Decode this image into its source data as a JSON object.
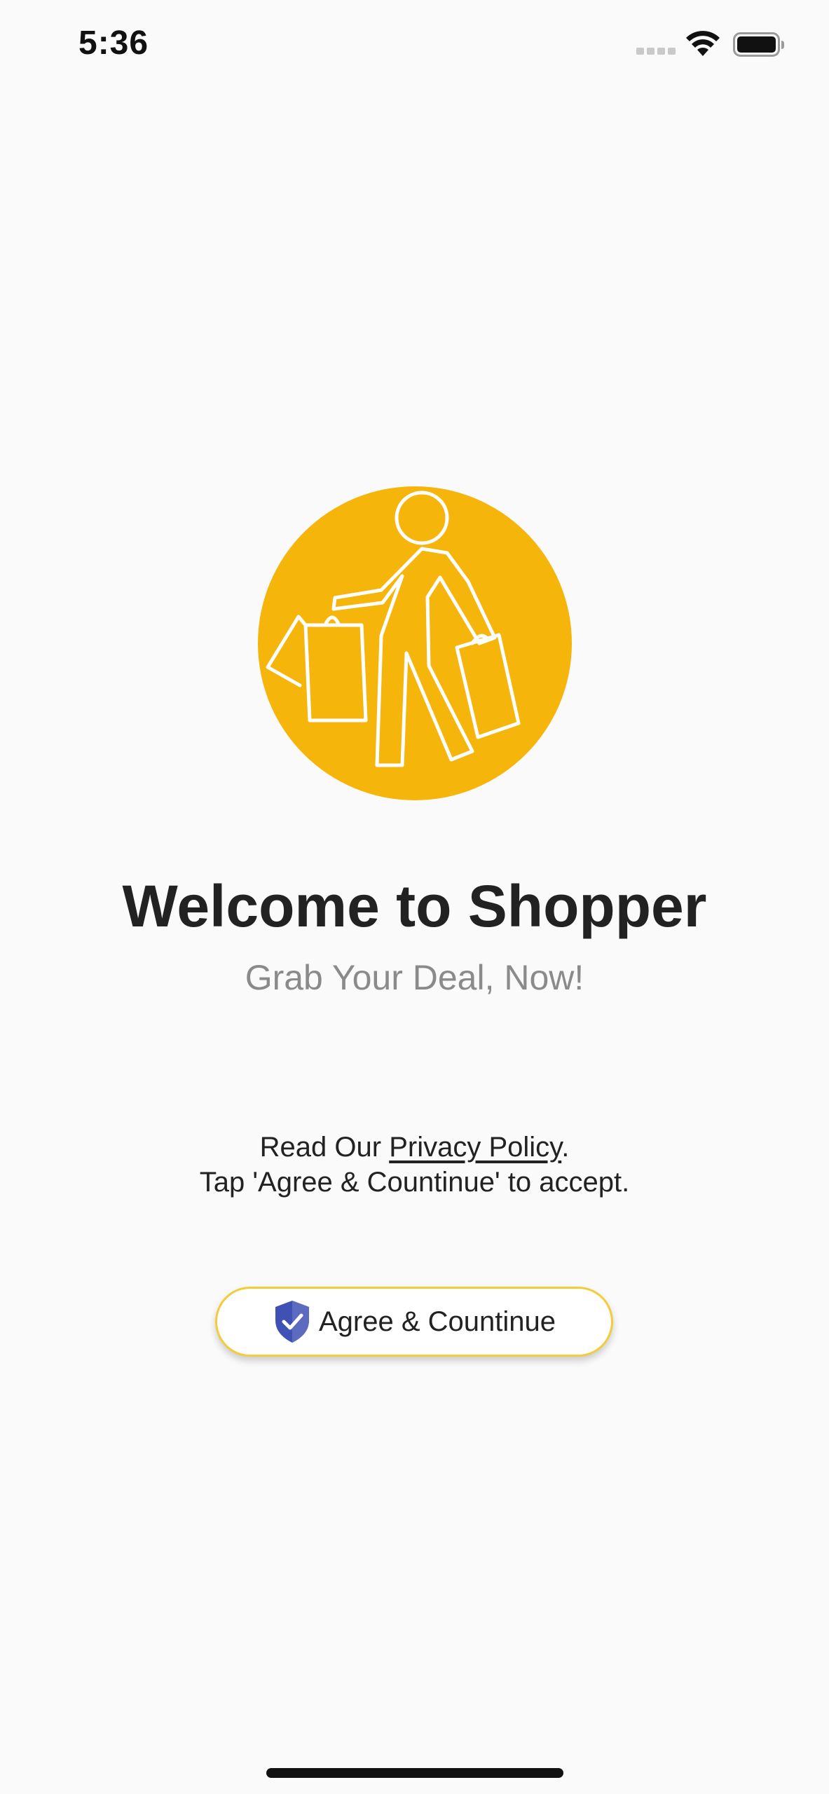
{
  "status_bar": {
    "time": "5:36",
    "icons": [
      "cellular-signal-icon",
      "wifi-icon",
      "battery-icon"
    ]
  },
  "logo": {
    "icon": "shopper-person-with-bags-icon",
    "color": "#f5b50a"
  },
  "welcome": {
    "title": "Welcome to Shopper",
    "subtitle": "Grab Your Deal, Now!"
  },
  "privacy": {
    "prefix": "Read Our ",
    "link_label": "Privacy Policy",
    "suffix": ".",
    "instruction": "Tap 'Agree & Countinue' to accept."
  },
  "agree_button": {
    "label": "Agree & Countinue",
    "icon": "shield-check-icon",
    "border_color": "#f3cc3c",
    "icon_color": "#3f51b5"
  }
}
